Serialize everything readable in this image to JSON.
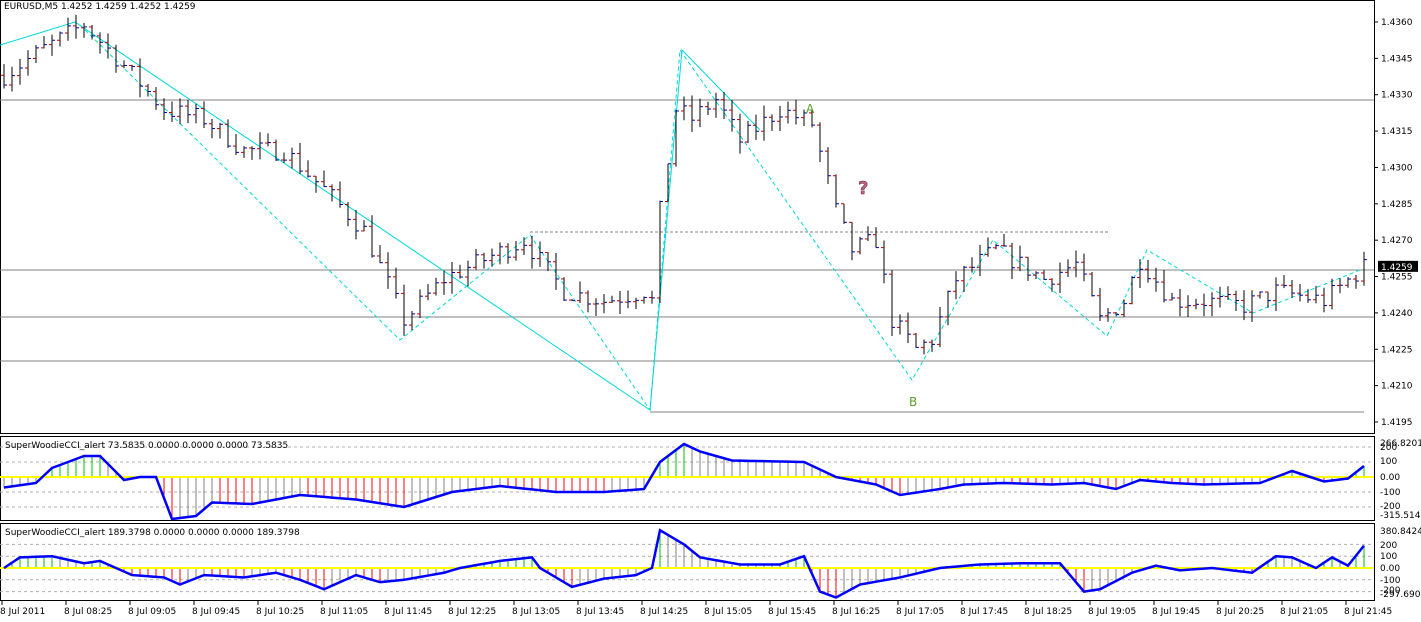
{
  "header": {
    "symbol_label": "EURUSD,M5  1.4252 1.4259 1.4252 1.4259"
  },
  "annotations": {
    "a": "A",
    "b": "B",
    "q": "?"
  },
  "colors": {
    "zigzag": "#00d8d8",
    "cci": "#0000ff",
    "zero": "#ffff00",
    "up": "#00c000",
    "down": "#ff0000",
    "neutral": "#808080"
  },
  "chart_data": [
    {
      "type": "bar",
      "title": "EURUSD,M5",
      "ylim": [
        1.4195,
        1.436
      ],
      "y_ticks": [
        "1.4360",
        "1.4345",
        "1.4330",
        "1.4315",
        "1.4300",
        "1.4285",
        "1.4270",
        "1.4255",
        "1.4240",
        "1.4225",
        "1.4210",
        "1.4195"
      ],
      "current_price": "1.4259",
      "x_ticks": [
        "8 Jul 2011",
        "8 Jul 08:25",
        "8 Jul 09:05",
        "8 Jul 09:45",
        "8 Jul 10:25",
        "8 Jul 11:05",
        "8 Jul 11:45",
        "8 Jul 12:25",
        "8 Jul 13:05",
        "8 Jul 13:45",
        "8 Jul 14:25",
        "8 Jul 15:05",
        "8 Jul 15:45",
        "8 Jul 16:25",
        "8 Jul 17:05",
        "8 Jul 17:45",
        "8 Jul 18:25",
        "8 Jul 19:05",
        "8 Jul 19:45",
        "8 Jul 20:25",
        "8 Jul 21:05",
        "8 Jul 21:45"
      ],
      "close_waypoints": [
        [
          0,
          1.4338
        ],
        [
          5,
          1.4349
        ],
        [
          10,
          1.4359
        ],
        [
          15,
          1.4342
        ],
        [
          20,
          1.4324
        ],
        [
          25,
          1.432
        ],
        [
          30,
          1.4307
        ],
        [
          35,
          1.4307
        ],
        [
          40,
          1.4291
        ],
        [
          45,
          1.4274
        ],
        [
          50,
          1.4237
        ],
        [
          55,
          1.4254
        ],
        [
          60,
          1.4262
        ],
        [
          65,
          1.427
        ],
        [
          70,
          1.4249
        ],
        [
          75,
          1.4245
        ],
        [
          80,
          1.4249
        ],
        [
          81,
          1.4245
        ],
        [
          82,
          1.4282
        ],
        [
          84,
          1.4324
        ],
        [
          86,
          1.432
        ],
        [
          89,
          1.4328
        ],
        [
          92,
          1.4311
        ],
        [
          97,
          1.4324
        ],
        [
          101,
          1.4318
        ],
        [
          104,
          1.4282
        ],
        [
          106,
          1.4266
        ],
        [
          109,
          1.427
        ],
        [
          111,
          1.4237
        ],
        [
          114,
          1.4225
        ],
        [
          116,
          1.4229
        ],
        [
          119,
          1.4254
        ],
        [
          124,
          1.4266
        ],
        [
          130,
          1.4254
        ],
        [
          134,
          1.426
        ],
        [
          137,
          1.4237
        ],
        [
          140,
          1.4245
        ],
        [
          142,
          1.4262
        ],
        [
          146,
          1.4245
        ],
        [
          150,
          1.4245
        ],
        [
          155,
          1.4243
        ],
        [
          159,
          1.4249
        ],
        [
          165,
          1.4245
        ],
        [
          170,
          1.4259
        ]
      ]
    },
    {
      "type": "line",
      "title": "SuperWoodieCCI_alert 73.5835 0.0000 0.0000 0.0000 73.5835",
      "ylim": [
        -315.514,
        266.8201
      ],
      "y_ticks": [
        "266.8201",
        "200",
        "100",
        "0.00",
        "-100",
        "-200",
        "-315.514"
      ],
      "waypoints": [
        [
          0,
          -70
        ],
        [
          4,
          -40
        ],
        [
          6,
          60
        ],
        [
          10,
          140
        ],
        [
          12,
          140
        ],
        [
          15,
          -20
        ],
        [
          17,
          0
        ],
        [
          19,
          0
        ],
        [
          21,
          -280
        ],
        [
          24,
          -260
        ],
        [
          26,
          -170
        ],
        [
          31,
          -180
        ],
        [
          37,
          -120
        ],
        [
          44,
          -150
        ],
        [
          50,
          -200
        ],
        [
          56,
          -100
        ],
        [
          62,
          -60
        ],
        [
          69,
          -100
        ],
        [
          75,
          -100
        ],
        [
          80,
          -80
        ],
        [
          82,
          100
        ],
        [
          85,
          220
        ],
        [
          87,
          170
        ],
        [
          91,
          110
        ],
        [
          100,
          100
        ],
        [
          104,
          0
        ],
        [
          109,
          -50
        ],
        [
          112,
          -120
        ],
        [
          117,
          -80
        ],
        [
          120,
          -50
        ],
        [
          125,
          -40
        ],
        [
          131,
          -50
        ],
        [
          135,
          -40
        ],
        [
          139,
          -80
        ],
        [
          142,
          -20
        ],
        [
          146,
          -40
        ],
        [
          150,
          -50
        ],
        [
          157,
          -40
        ],
        [
          161,
          40
        ],
        [
          165,
          -30
        ],
        [
          168,
          -10
        ],
        [
          170,
          73.58
        ]
      ]
    },
    {
      "type": "line",
      "title": "SuperWoodieCCI_alert 189.3798 0.0000 0.0000 0.0000 189.3798",
      "ylim": [
        -297.69,
        380.8424
      ],
      "y_ticks": [
        "380.8424",
        "200",
        "100",
        "0.00",
        "-100",
        "-200",
        "-297.690"
      ],
      "waypoints": [
        [
          0,
          0
        ],
        [
          2,
          90
        ],
        [
          6,
          100
        ],
        [
          10,
          40
        ],
        [
          12,
          60
        ],
        [
          16,
          -60
        ],
        [
          20,
          -80
        ],
        [
          22,
          -140
        ],
        [
          25,
          -60
        ],
        [
          30,
          -80
        ],
        [
          34,
          -40
        ],
        [
          37,
          -100
        ],
        [
          40,
          -180
        ],
        [
          44,
          -60
        ],
        [
          47,
          -120
        ],
        [
          50,
          -100
        ],
        [
          55,
          -40
        ],
        [
          57,
          0
        ],
        [
          62,
          60
        ],
        [
          66,
          90
        ],
        [
          67,
          0
        ],
        [
          71,
          -160
        ],
        [
          75,
          -90
        ],
        [
          79,
          -60
        ],
        [
          81,
          0
        ],
        [
          82,
          320
        ],
        [
          85,
          200
        ],
        [
          87,
          90
        ],
        [
          92,
          30
        ],
        [
          97,
          30
        ],
        [
          100,
          100
        ],
        [
          102,
          -200
        ],
        [
          104,
          -250
        ],
        [
          107,
          -140
        ],
        [
          112,
          -80
        ],
        [
          117,
          0
        ],
        [
          122,
          30
        ],
        [
          127,
          40
        ],
        [
          132,
          40
        ],
        [
          135,
          -200
        ],
        [
          137,
          -180
        ],
        [
          141,
          -40
        ],
        [
          144,
          20
        ],
        [
          147,
          -20
        ],
        [
          151,
          0
        ],
        [
          156,
          -40
        ],
        [
          159,
          100
        ],
        [
          161,
          90
        ],
        [
          164,
          0
        ],
        [
          166,
          90
        ],
        [
          168,
          20
        ],
        [
          170,
          189.38
        ]
      ]
    }
  ]
}
